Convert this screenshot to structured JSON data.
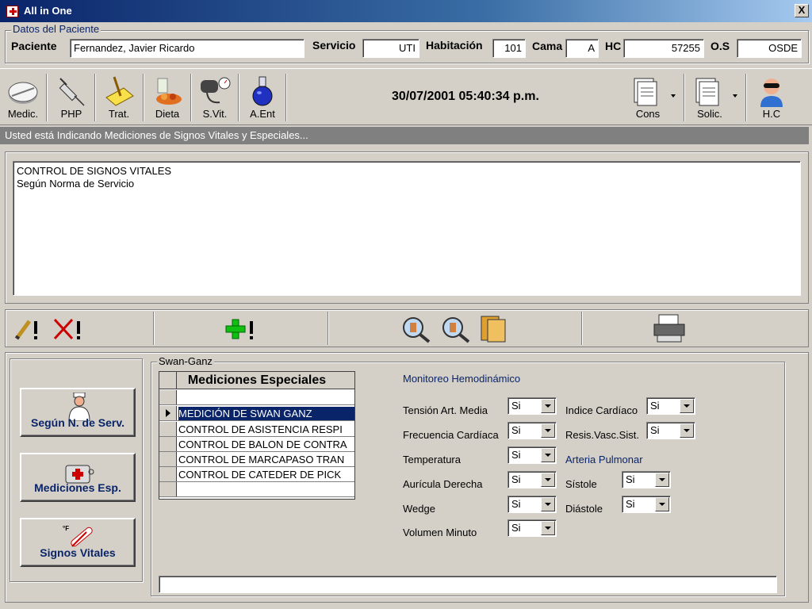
{
  "window": {
    "title": "All in One",
    "close_label": "X"
  },
  "patient": {
    "group_label": "Datos del Paciente",
    "paciente_label": "Paciente",
    "paciente_value": "Fernandez, Javier Ricardo",
    "servicio_label": "Servicio",
    "servicio_value": "UTI",
    "habitacion_label": "Habitación",
    "habitacion_value": "101",
    "cama_label": "Cama",
    "cama_value": "A",
    "hc_label": "HC",
    "hc_value": "57255",
    "os_label": "O.S",
    "os_value": "OSDE"
  },
  "toolbar": {
    "buttons": [
      {
        "label": "Medic.",
        "icon": "pill-icon"
      },
      {
        "label": "PHP",
        "icon": "syringe-icon"
      },
      {
        "label": "Trat.",
        "icon": "treatment-icon"
      },
      {
        "label": "Dieta",
        "icon": "food-icon"
      },
      {
        "label": "S.Vit.",
        "icon": "blood-pressure-icon"
      },
      {
        "label": "A.Ent",
        "icon": "flask-icon"
      }
    ],
    "datetime": "30/07/2001 05:40:34 p.m.",
    "cons_label": "Cons",
    "solic_label": "Solic.",
    "hc_label": "H.C"
  },
  "status_text": "Usted está Indicando Mediciones de Signos Vitales y Especiales...",
  "notes": {
    "line1": "CONTROL DE SIGNOS VITALES",
    "line2": "Según Norma de Servicio"
  },
  "left_buttons": {
    "segun_norma": "Según N. de Serv.",
    "mediciones_esp": "Mediciones Esp.",
    "signos_vitales": "Signos Vitales"
  },
  "swan": {
    "group_label": "Swan-Ganz",
    "grid_header": "Mediciones Especiales",
    "rows": [
      "",
      "MEDICIÓN DE SWAN GANZ",
      "CONTROL DE ASISTENCIA RESPI",
      "CONTROL DE BALON DE CONTRA",
      "CONTROL DE MARCAPASO TRAN",
      "CONTROL DE CATEDER DE PICK",
      ""
    ],
    "monitor_title": "Monitoreo Hemodinámico",
    "arteria_title": "Arteria Pulmonar",
    "left_fields": [
      {
        "label": "Tensión Art. Media",
        "value": "Si"
      },
      {
        "label": "Frecuencia Cardíaca",
        "value": "Si"
      },
      {
        "label": "Temperatura",
        "value": "Si"
      },
      {
        "label": "Aurícula Derecha",
        "value": "Si"
      },
      {
        "label": "Wedge",
        "value": "Si"
      },
      {
        "label": "Volumen Minuto",
        "value": "Si"
      }
    ],
    "right_fields": [
      {
        "label": "Indice Cardíaco",
        "value": "Si"
      },
      {
        "label": "Resis.Vasc.Sist.",
        "value": "Si"
      },
      {
        "label": "Sístole",
        "value": "Si"
      },
      {
        "label": "Diástole",
        "value": "Si"
      }
    ]
  }
}
